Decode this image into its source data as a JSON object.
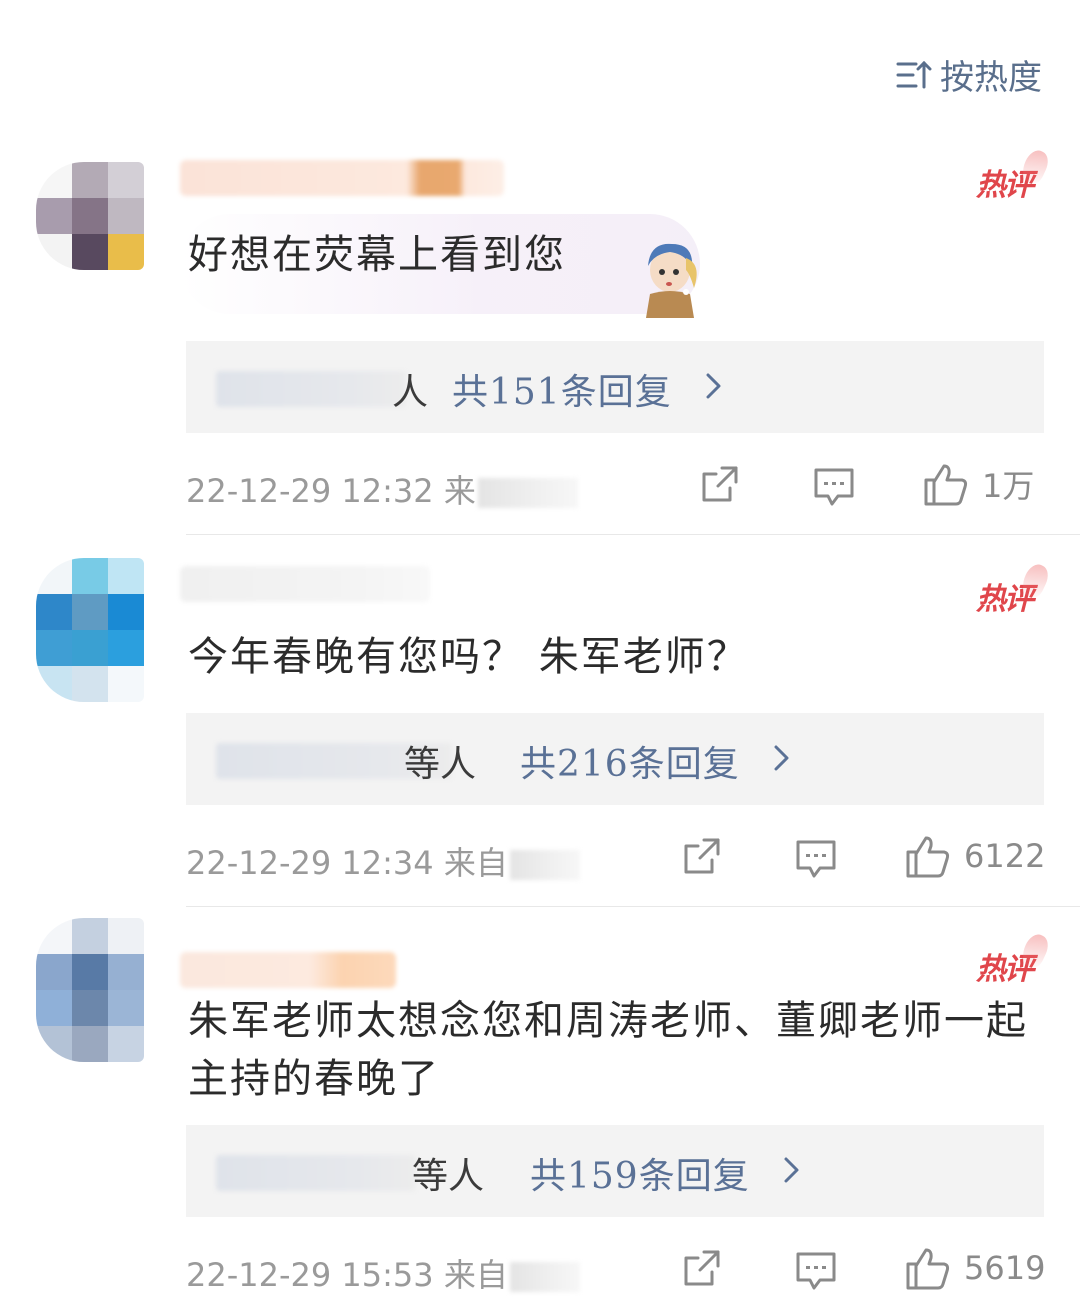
{
  "sort": {
    "label": "按热度",
    "icon": "sort-icon"
  },
  "comments": [
    {
      "hot_label": "热评",
      "text": "好想在荧幕上看到您",
      "reply_suffix": "人",
      "reply_count": "共151条回复",
      "time": "22-12-29 12:32 来",
      "likes": "1万"
    },
    {
      "hot_label": "热评",
      "text": "今年春晚有您吗？ 朱军老师？",
      "reply_suffix": "等人",
      "reply_count": "共216条回复",
      "time": "22-12-29 12:34 来自",
      "likes": "6122"
    },
    {
      "hot_label": "热评",
      "text": "朱军老师太想念您和周涛老师、董卿老师一起主持的春晚了",
      "reply_suffix": "等人",
      "reply_count": "共159条回复",
      "time": "22-12-29 15:53 来自",
      "likes": "5619"
    }
  ],
  "icons": {
    "share": "share-icon",
    "comment": "comment-icon",
    "like": "thumbs-up-icon",
    "chevron": "chevron-right-icon"
  },
  "colors": {
    "link": "#5a7196",
    "hot": "#e0464b",
    "meta": "#9a9a9a"
  }
}
